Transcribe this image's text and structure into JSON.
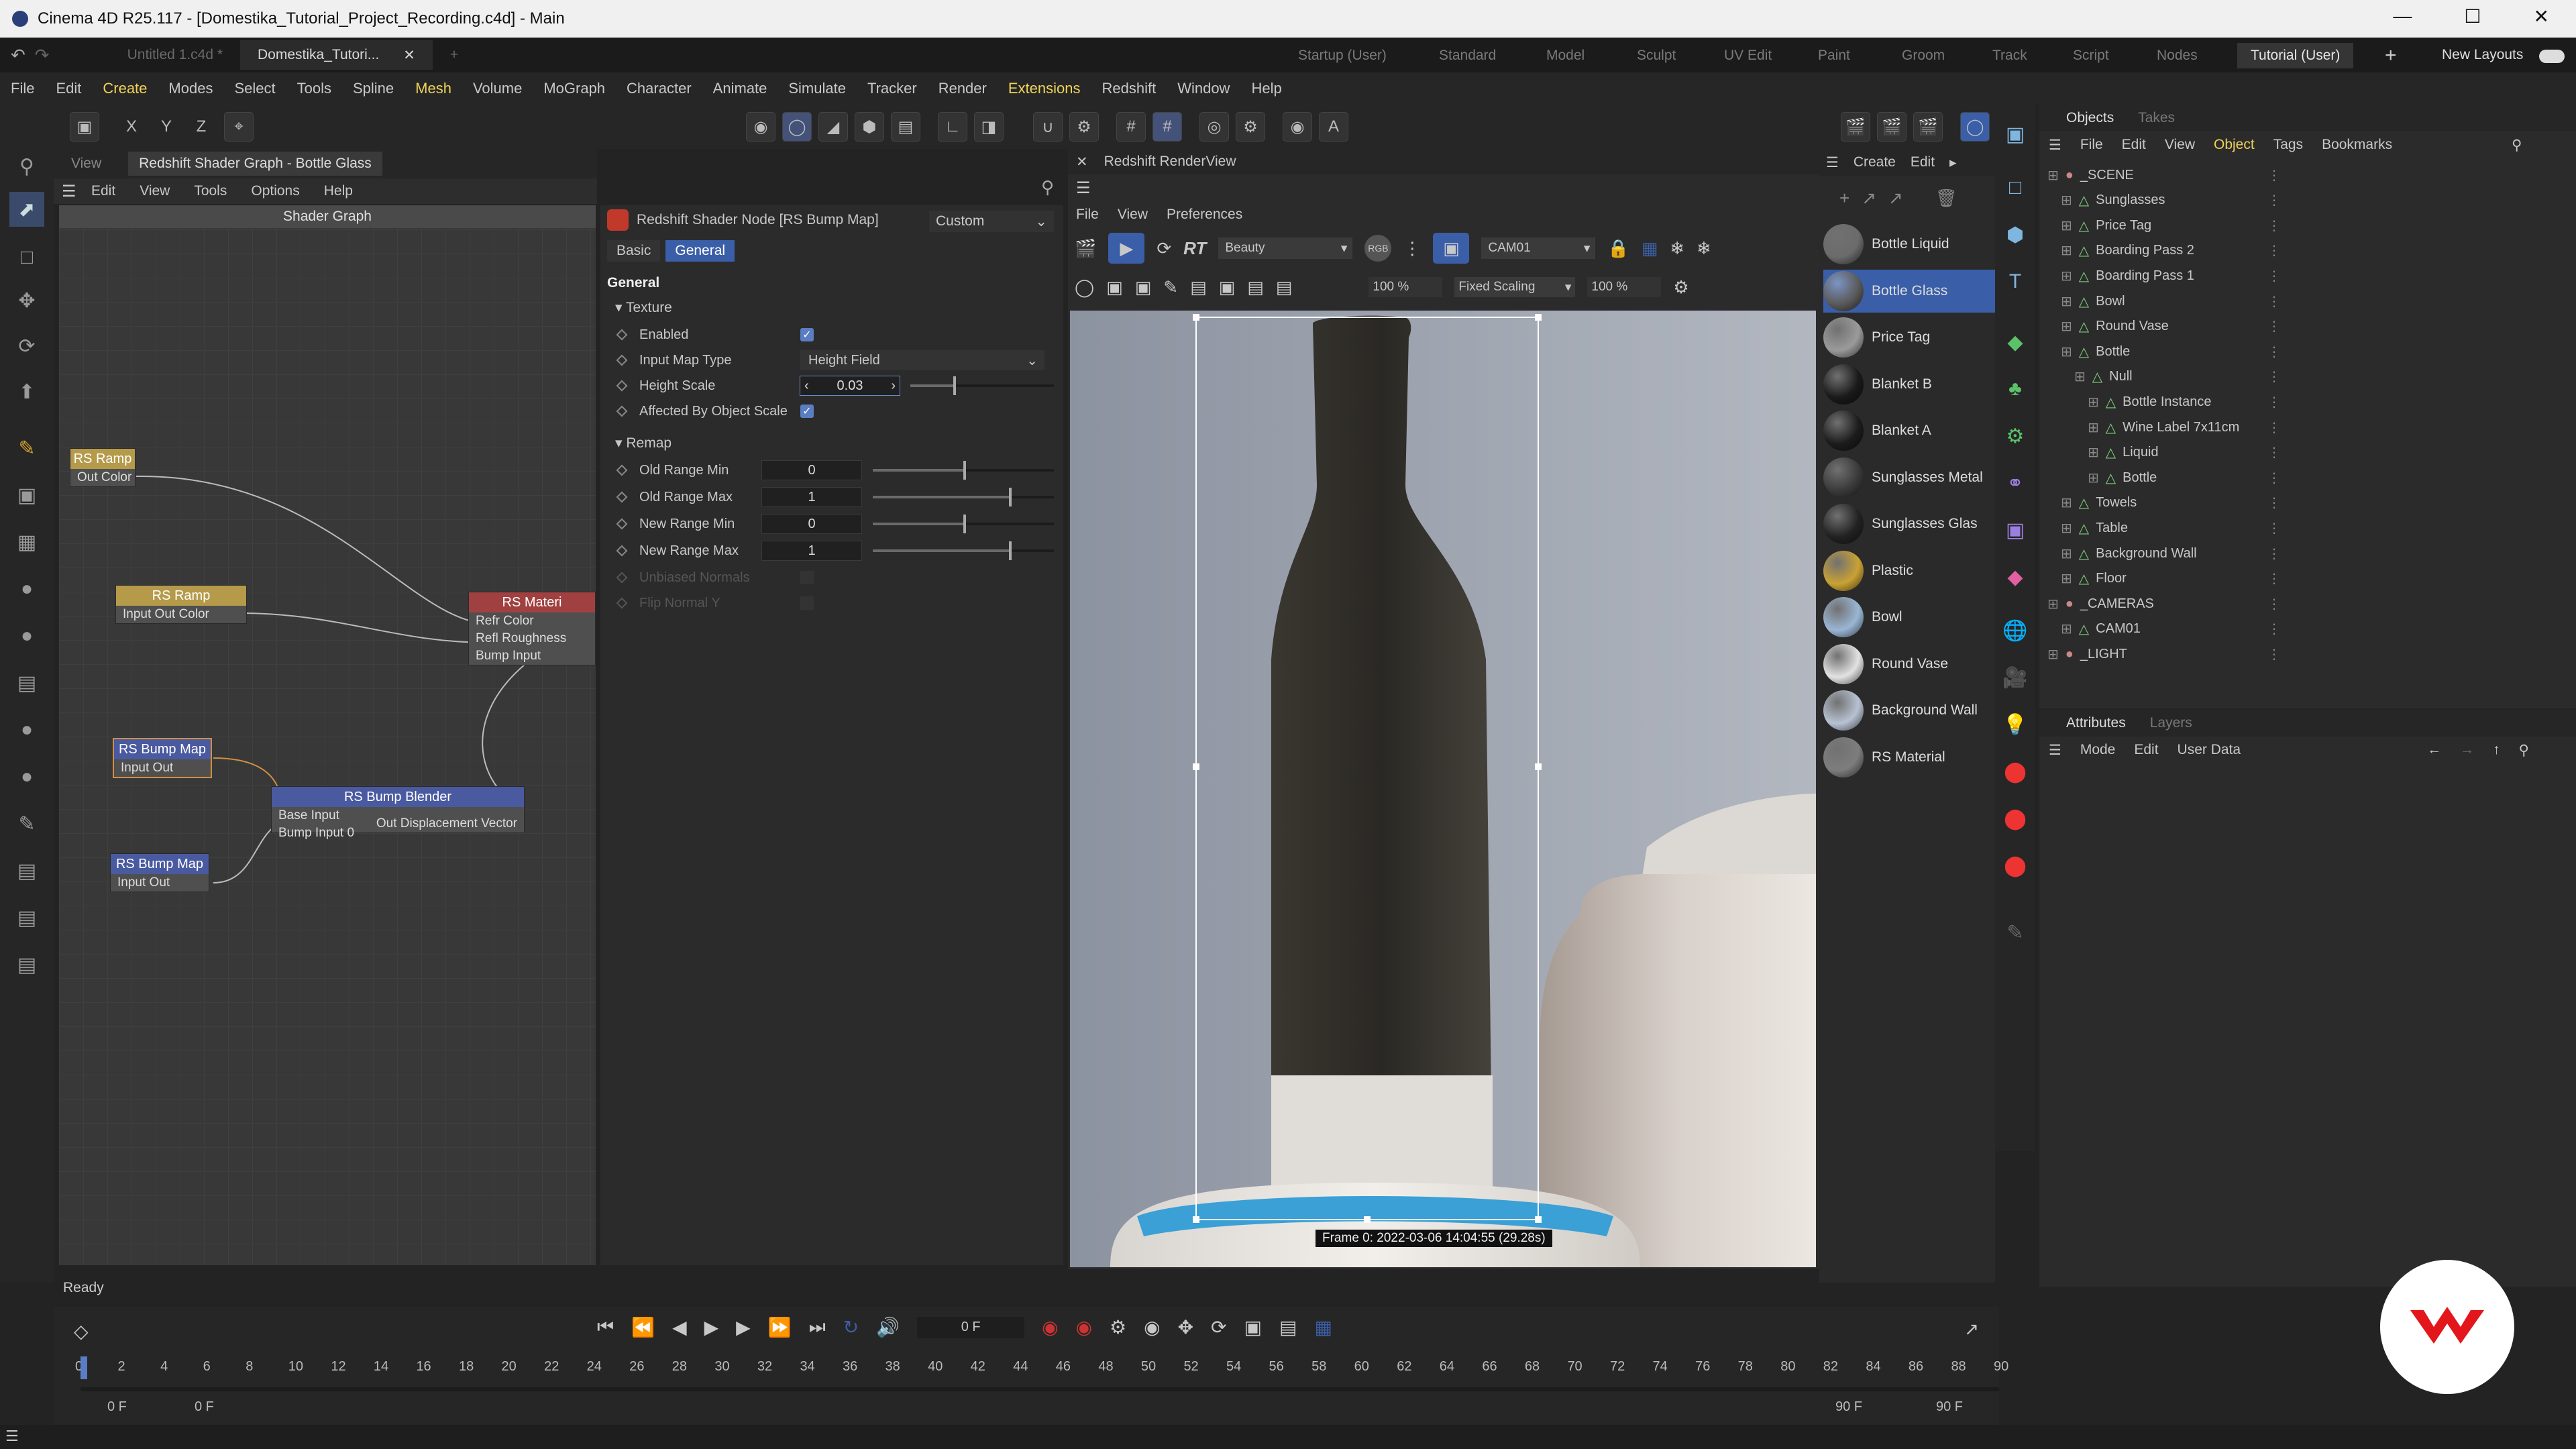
{
  "titlebar": {
    "title": "Cinema 4D R25.117 - [Domestika_Tutorial_Project_Recording.c4d] - Main"
  },
  "doc_tabs": [
    "Untitled 1.c4d *",
    "Domestika_Tutori...",
    "+"
  ],
  "layouts": [
    "Startup (User)",
    "Standard",
    "Model",
    "Sculpt",
    "UV Edit",
    "Paint",
    "Groom",
    "Track",
    "Script",
    "Nodes",
    "Tutorial (User)"
  ],
  "new_layouts_label": "New Layouts",
  "menu": [
    "File",
    "Edit",
    "Create",
    "Modes",
    "Select",
    "Tools",
    "Spline",
    "Mesh",
    "Volume",
    "MoGraph",
    "Character",
    "Animate",
    "Simulate",
    "Tracker",
    "Render",
    "Extensions",
    "Redshift",
    "Window",
    "Help"
  ],
  "axis_labels": [
    "X",
    "Y",
    "Z"
  ],
  "shader_graph": {
    "view_tab": "View",
    "title": "Redshift Shader Graph - Bottle Glass",
    "menu": [
      "Edit",
      "View",
      "Tools",
      "Options",
      "Help"
    ],
    "graph_title": "Shader Graph",
    "status": "Ready",
    "nodes": [
      {
        "title": "RS Ramp",
        "ports": [
          "Out Color"
        ]
      },
      {
        "title": "RS Ramp",
        "ports": [
          "Input   Out Color"
        ]
      },
      {
        "title": "RS Materi",
        "ports": [
          "Refr Color",
          "Refl Roughness",
          "Bump Input"
        ]
      },
      {
        "title": "RS Bump Map",
        "ports": [
          "Input   Out"
        ]
      },
      {
        "title": "RS Bump Blender",
        "ports": [
          "Base Input",
          "Bump Input 0",
          "Out Displacement Vector"
        ]
      },
      {
        "title": "RS Bump Map",
        "ports": [
          "Input   Out"
        ]
      }
    ]
  },
  "attributes": {
    "node_title": "Redshift Shader Node [RS Bump Map]",
    "mode": "Custom",
    "tabs": [
      "Basic",
      "General"
    ],
    "section": "General",
    "texture_group": "Texture",
    "remap_group": "Remap",
    "enabled_label": "Enabled",
    "input_map_type_label": "Input Map Type",
    "input_map_type_value": "Height Field",
    "height_scale_label": "Height Scale",
    "height_scale_value": "0.03",
    "height_scale_fraction": 0.3,
    "affected_label": "Affected By Object Scale",
    "old_min_label": "Old Range Min",
    "old_min": "0",
    "old_min_fraction": 0.5,
    "old_max_label": "Old Range Max",
    "old_max": "1",
    "old_max_fraction": 0.75,
    "new_min_label": "New Range Min",
    "new_min": "0",
    "new_min_fraction": 0.5,
    "new_max_label": "New Range Max",
    "new_max": "1",
    "new_max_fraction": 0.75,
    "unbiased_label": "Unbiased Normals",
    "flip_label": "Flip Normal Y"
  },
  "renderview": {
    "title": "Redshift RenderView",
    "menu": [
      "File",
      "View",
      "Preferences"
    ],
    "rt_label": "RT",
    "aov": "Beauty",
    "camera": "CAM01",
    "zoom": "100 %",
    "scaling": "Fixed Scaling",
    "scale_pct": "100 %",
    "frame_info": "Frame  0:  2022-03-06  14:04:55  (29.28s)"
  },
  "materials": {
    "menu": [
      "Create",
      "Edit"
    ],
    "items": [
      {
        "name": "Bottle Liquid",
        "color": "#6b6b6b"
      },
      {
        "name": "Bottle Glass",
        "color": "#5a5a5a"
      },
      {
        "name": "Price Tag",
        "color": "#9a9a9a"
      },
      {
        "name": "Blanket B",
        "color": "#1a1a1a"
      },
      {
        "name": "Blanket A",
        "color": "#1c1c1c"
      },
      {
        "name": "Sunglasses Metal",
        "color": "#3a3a3a"
      },
      {
        "name": "Sunglasses Glas",
        "color": "#222222"
      },
      {
        "name": "Plastic",
        "color": "#c9a234"
      },
      {
        "name": "Bowl",
        "color": "#9ab6d4"
      },
      {
        "name": "Round Vase",
        "color": "#e2e2e2"
      },
      {
        "name": "Background Wall",
        "color": "#b7c2d2"
      },
      {
        "name": "RS Material",
        "color": "#7d7d7d"
      }
    ]
  },
  "objects_panel": {
    "tabs": [
      "Objects",
      "Takes"
    ],
    "menu": [
      "File",
      "Edit",
      "View",
      "Object",
      "Tags",
      "Bookmarks"
    ],
    "rows": [
      {
        "name": "_SCENE",
        "depth": 0
      },
      {
        "name": "Sunglasses",
        "depth": 1
      },
      {
        "name": "Price Tag",
        "depth": 1
      },
      {
        "name": "Boarding Pass 2",
        "depth": 1
      },
      {
        "name": "Boarding Pass 1",
        "depth": 1
      },
      {
        "name": "Bowl",
        "depth": 1
      },
      {
        "name": "Round Vase",
        "depth": 1
      },
      {
        "name": "Bottle",
        "depth": 1
      },
      {
        "name": "Null",
        "depth": 2
      },
      {
        "name": "Bottle Instance",
        "depth": 3
      },
      {
        "name": "Wine Label 7x11cm",
        "depth": 3
      },
      {
        "name": "Liquid",
        "depth": 3
      },
      {
        "name": "Bottle",
        "depth": 3
      },
      {
        "name": "Towels",
        "depth": 1
      },
      {
        "name": "Table",
        "depth": 1
      },
      {
        "name": "Background Wall",
        "depth": 1
      },
      {
        "name": "Floor",
        "depth": 1
      },
      {
        "name": "_CAMERAS",
        "depth": 0
      },
      {
        "name": "CAM01",
        "depth": 1
      },
      {
        "name": "_LIGHT",
        "depth": 0
      }
    ]
  },
  "attributes_panel": {
    "tabs": [
      "Attributes",
      "Layers"
    ],
    "menu": [
      "Mode",
      "Edit",
      "User Data"
    ]
  },
  "timeline": {
    "current_frame": "0 F",
    "ruler": [
      "0",
      "2",
      "4",
      "6",
      "8",
      "10",
      "12",
      "14",
      "16",
      "18",
      "20",
      "22",
      "24",
      "26",
      "28",
      "30",
      "32",
      "34",
      "36",
      "38",
      "40",
      "42",
      "44",
      "46",
      "48",
      "50",
      "52",
      "54",
      "56",
      "58",
      "60",
      "62",
      "64",
      "66",
      "68",
      "70",
      "72",
      "74",
      "76",
      "78",
      "80",
      "82",
      "84",
      "86",
      "88",
      "90"
    ],
    "start": "0 F",
    "start2": "0 F",
    "end": "90 F",
    "end2": "90 F"
  },
  "colors": {
    "accent": "#5a7dc4",
    "selection": "#3a5fa8",
    "highlight_menu": "#f0d35a",
    "logo": "#e3161b"
  }
}
